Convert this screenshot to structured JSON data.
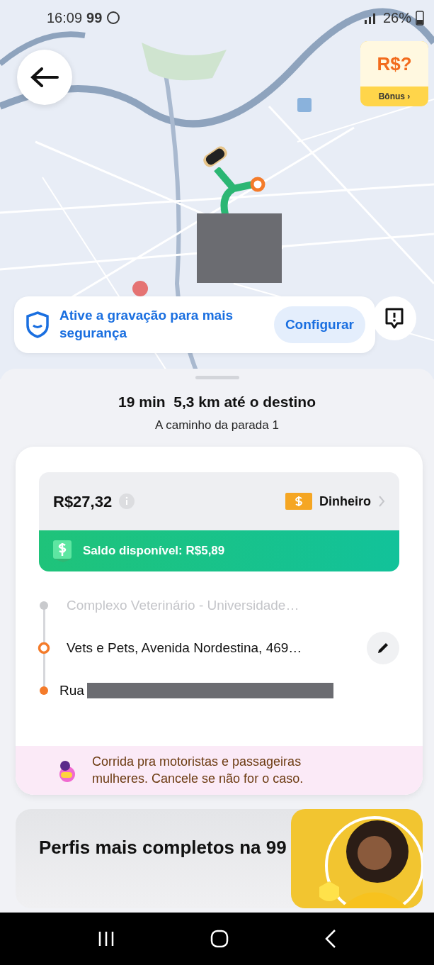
{
  "status_bar": {
    "time": "16:09",
    "app_badge": "99",
    "battery": "26%"
  },
  "map": {
    "bonus_badge": {
      "amount": "R$?",
      "label": "Bônus ›"
    }
  },
  "safety_banner": {
    "message": "Ative a gravação para mais segurança",
    "button": "Configurar"
  },
  "trip": {
    "eta": "19 min  5,3 km até o destino",
    "subtitle": "A caminho da parada 1"
  },
  "fare": {
    "price": "R$27,32",
    "payment_method": "Dinheiro",
    "balance": "Saldo disponível: R$5,89"
  },
  "stops": [
    {
      "kind": "origin",
      "address": "Complexo Veterinário - Universidade…"
    },
    {
      "kind": "stop",
      "address": "Vets e Pets, Avenida Nordestina, 469…"
    },
    {
      "kind": "destination",
      "address": "Rua"
    }
  ],
  "notice": "Corrida pra motoristas e passageiras mulheres. Cancele se não for o caso.",
  "promo": {
    "title": "Perfis mais completos na 99"
  }
}
